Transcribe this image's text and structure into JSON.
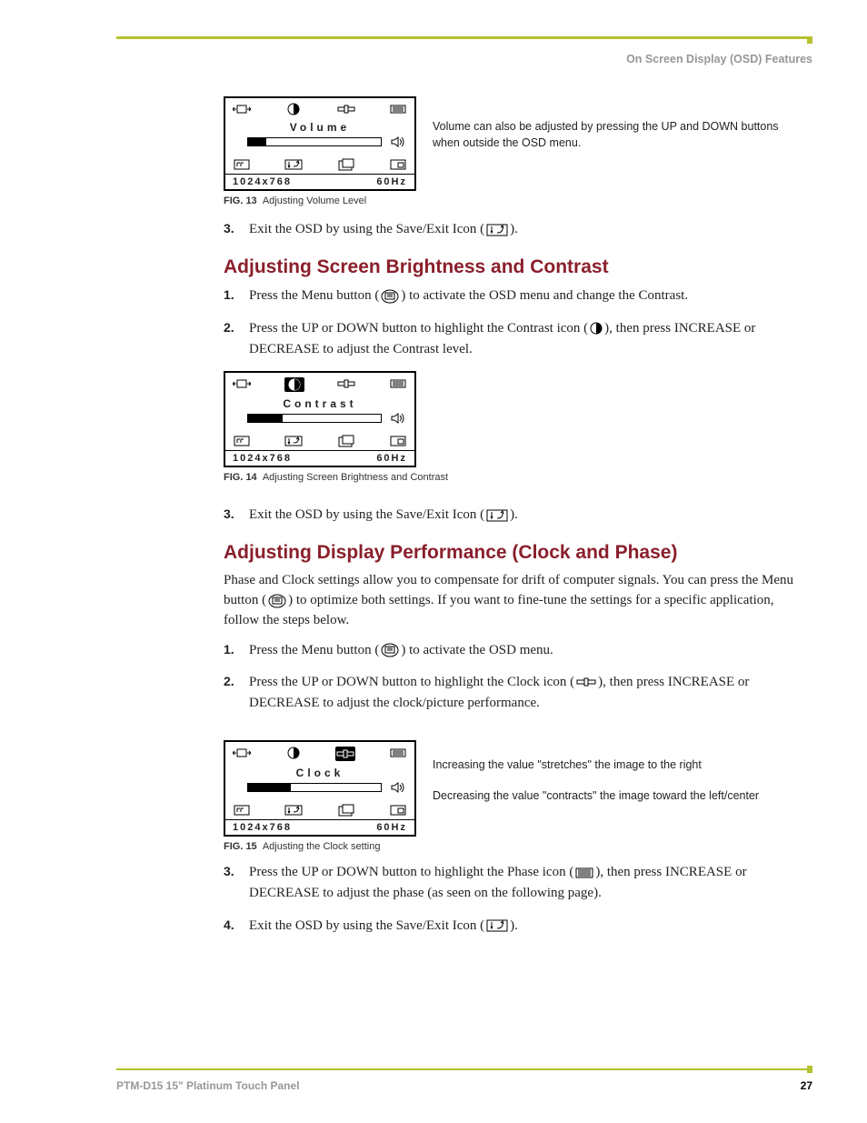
{
  "header": {
    "section": "On Screen Display (OSD) Features"
  },
  "osd_common": {
    "resolution": "1024x768",
    "refresh": "60Hz"
  },
  "fig13": {
    "title": "Volume",
    "caption_label": "FIG. 13",
    "caption_text": "Adjusting Volume Level",
    "side_note": "Volume can also be adjusted by pressing the UP and DOWN buttons when outside the OSD menu.",
    "slider_fill_pct": 14
  },
  "step_a3": {
    "num": "3.",
    "text_before": "Exit the OSD by using the Save/Exit Icon (",
    "text_after": ")."
  },
  "sec_brightness": {
    "heading": "Adjusting Screen Brightness and Contrast",
    "steps": [
      {
        "num": "1.",
        "before": "Press the Menu button (",
        "after": ") to activate the OSD menu and change the Contrast."
      },
      {
        "num": "2.",
        "before": "Press the UP or DOWN button to highlight the Contrast icon (",
        "after": "), then press INCREASE or DECREASE to adjust the Contrast level."
      }
    ]
  },
  "fig14": {
    "title": "Contrast",
    "caption_label": "FIG. 14",
    "caption_text": "Adjusting Screen Brightness and Contrast",
    "slider_fill_pct": 26
  },
  "step_b3": {
    "num": "3.",
    "text_before": "Exit the OSD by using the Save/Exit Icon (",
    "text_after": ")."
  },
  "sec_clock": {
    "heading": "Adjusting Display Performance (Clock and Phase)",
    "intro_before": "Phase and Clock settings allow you to compensate for drift of computer signals. You can press the Menu button (",
    "intro_after": ") to optimize both settings. If you want to fine-tune the settings for a specific application, follow the steps below.",
    "steps": [
      {
        "num": "1.",
        "before": "Press the Menu button (",
        "after": ") to activate the OSD menu."
      },
      {
        "num": "2.",
        "before": "Press the UP or DOWN button to highlight the Clock icon (",
        "after": "), then press INCREASE or DECREASE to adjust the clock/picture performance."
      }
    ],
    "side_notes": {
      "inc": "Increasing the value \"stretches\" the image to the right",
      "dec": "Decreasing the value \"contracts\" the image toward the left/center"
    }
  },
  "fig15": {
    "title": "Clock",
    "caption_label": "FIG. 15",
    "caption_text": "Adjusting the Clock setting",
    "slider_fill_pct": 32
  },
  "steps_c": [
    {
      "num": "3.",
      "before": "Press the UP or DOWN button to highlight the Phase icon (",
      "after": "), then press INCREASE or DECREASE to adjust the phase (as seen on the following page)."
    },
    {
      "num": "4.",
      "before": "Exit the OSD by using the Save/Exit Icon (",
      "after": ")."
    }
  ],
  "footer": {
    "product": "PTM-D15 15\" Platinum Touch Panel",
    "page": "27"
  }
}
